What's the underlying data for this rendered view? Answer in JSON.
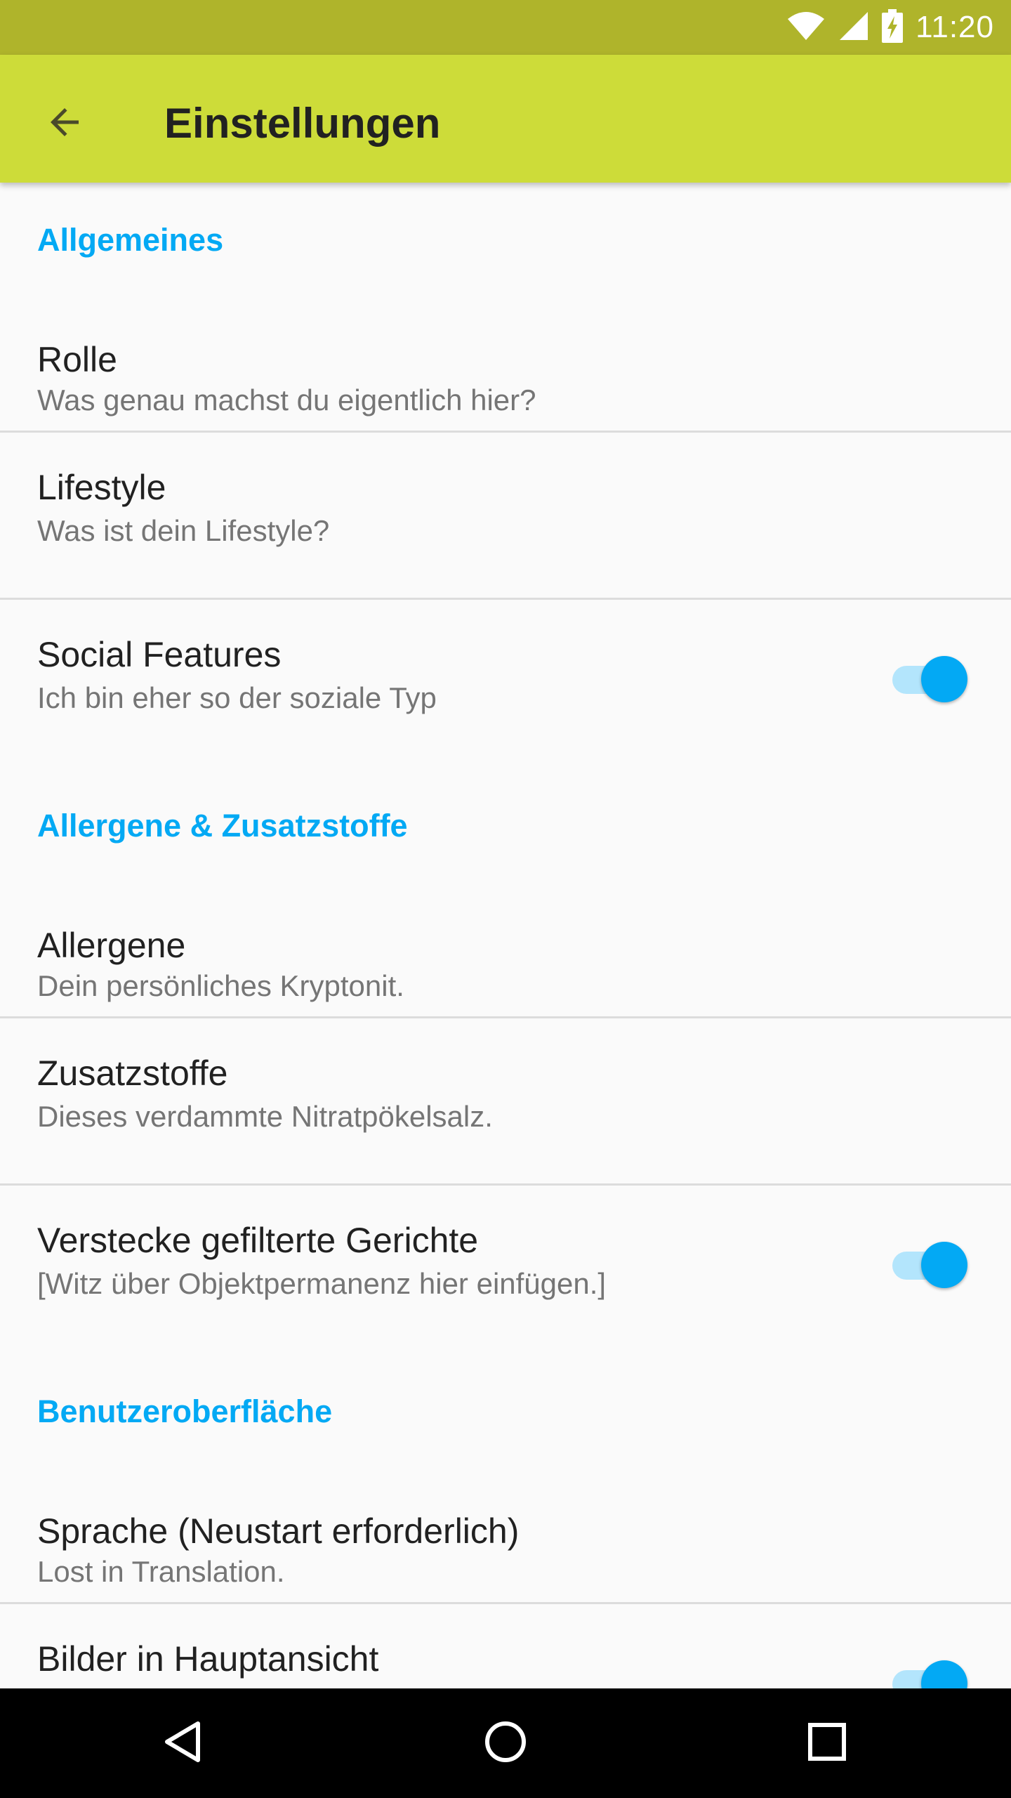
{
  "status_bar": {
    "time": "11:20",
    "icons": [
      "wifi-icon",
      "signal-icon",
      "battery-charging-icon"
    ],
    "background": "#afb42b"
  },
  "app_bar": {
    "title": "Einstellungen",
    "back_icon": "arrow-back-icon",
    "background": "#cddc39"
  },
  "colors": {
    "accent": "#03a9f4",
    "switch_track": "#b3e5fc",
    "text_primary": "#212121",
    "text_secondary": "#757575"
  },
  "sections": [
    {
      "header": "Allgemeines",
      "items": [
        {
          "title": "Rolle",
          "summary": "Was genau machst du eigentlich hier?",
          "switch": null
        },
        {
          "title": "Lifestyle",
          "summary": "Was ist dein Lifestyle?",
          "switch": null
        },
        {
          "title": "Social Features",
          "summary": "Ich bin eher so der soziale Typ",
          "switch": true
        }
      ]
    },
    {
      "header": "Allergene & Zusatzstoffe",
      "items": [
        {
          "title": "Allergene",
          "summary": "Dein persönliches Kryptonit.",
          "switch": null
        },
        {
          "title": "Zusatzstoffe",
          "summary": "Dieses verdammte Nitratpökelsalz.",
          "switch": null
        },
        {
          "title": "Verstecke gefilterte Gerichte",
          "summary": "[Witz über Objektpermanenz hier einfügen.]",
          "switch": true
        }
      ]
    },
    {
      "header": "Benutzeroberfläche",
      "items": [
        {
          "title": "Sprache (Neustart erforderlich)",
          "summary": "Lost in Translation.",
          "switch": null
        },
        {
          "title": "Bilder in Hauptansicht",
          "summary": "",
          "switch": true
        }
      ]
    }
  ],
  "nav_bar": {
    "icons": [
      "back-triangle-icon",
      "home-circle-icon",
      "recents-square-icon"
    ]
  }
}
